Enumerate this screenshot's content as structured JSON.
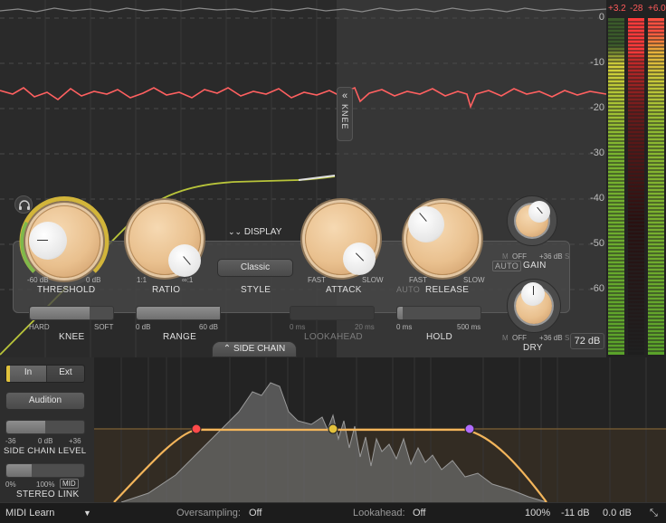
{
  "db_scale": [
    "0",
    "-10",
    "-20",
    "-30",
    "-40",
    "-50",
    "-60"
  ],
  "knee_tab": {
    "label": "KNEE"
  },
  "display_toggle": {
    "label": "DISPLAY"
  },
  "threshold": {
    "label": "THRESHOLD",
    "min": "-60 dB",
    "max": "0 dB"
  },
  "ratio": {
    "label": "RATIO",
    "min": "1:1",
    "max": "∞:1"
  },
  "style": {
    "label": "STYLE",
    "value": "Classic"
  },
  "attack": {
    "label": "ATTACK",
    "min": "FAST",
    "max": "SLOW"
  },
  "release": {
    "label": "RELEASE",
    "auto": "AUTO",
    "min": "FAST",
    "max": "SLOW"
  },
  "gain": {
    "label": "GAIN",
    "auto": "AUTO",
    "off": "OFF",
    "max": "+36 dB",
    "m": "M",
    "s": "S"
  },
  "dry": {
    "label": "DRY",
    "off": "OFF",
    "max": "+36 dB",
    "m": "M",
    "s": "S"
  },
  "knee_slider": {
    "label": "KNEE",
    "min": "HARD",
    "max": "SOFT",
    "fill": 0.72
  },
  "range_slider": {
    "label": "RANGE",
    "min": "0 dB",
    "max": "60 dB",
    "fill": 1.0
  },
  "lookahead_slider": {
    "label": "LOOKAHEAD",
    "min": "0 ms",
    "max": "20 ms"
  },
  "hold_slider": {
    "label": "HOLD",
    "min": "0 ms",
    "max": "500 ms"
  },
  "side_chain_toggle": {
    "label": "SIDE CHAIN"
  },
  "range_readout": "72 dB",
  "meters": {
    "left_peak": "+3.2",
    "mid_peak": "-28",
    "right_peak": "+6.0"
  },
  "sc_panel": {
    "in_label": "In",
    "ext_label": "Ext",
    "audition_label": "Audition",
    "level": {
      "label": "SIDE CHAIN LEVEL",
      "min": "-36",
      "mid": "0 dB",
      "max": "+36"
    },
    "stereo": {
      "label": "STEREO LINK",
      "min": "0%",
      "max": "100%",
      "mid_btn": "MID"
    }
  },
  "bottom_bar": {
    "midi_learn": "MIDI Learn",
    "oversampling_label": "Oversampling:",
    "oversampling_value": "Off",
    "lookahead_label": "Lookahead:",
    "lookahead_value": "Off",
    "zoom": "100%",
    "input_gain": "-11 dB",
    "output_gain": "0.0 dB"
  },
  "colors": {
    "accent_yellow": "#d2b53a",
    "curve_red": "#ff6060",
    "node_red": "#ff4a4a",
    "node_yellow": "#e4c23c",
    "node_purple": "#b06cff",
    "eq_curve": "#f3b55b"
  }
}
